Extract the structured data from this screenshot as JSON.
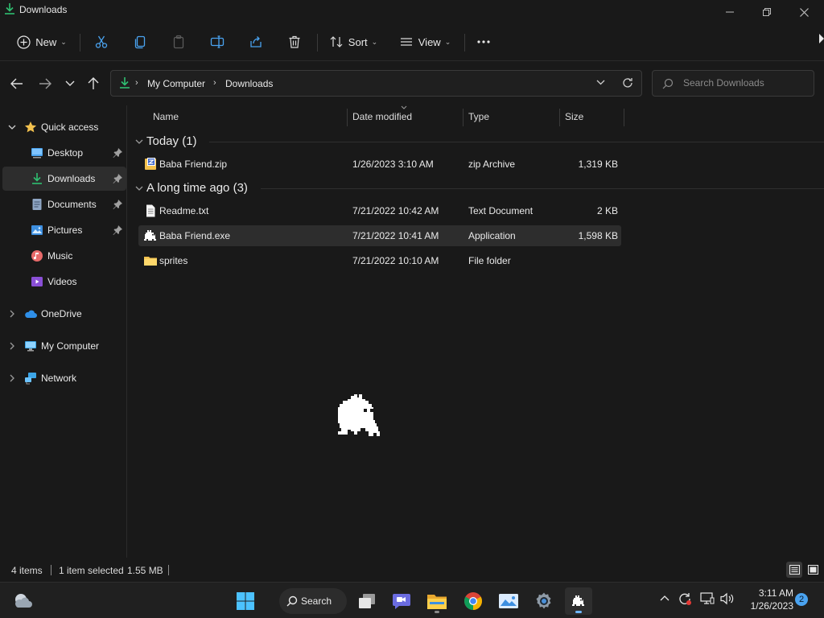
{
  "window": {
    "title": "Downloads"
  },
  "toolbar": {
    "new_label": "New",
    "sort_label": "Sort",
    "view_label": "View"
  },
  "address": {
    "segments": [
      "My Computer",
      "Downloads"
    ]
  },
  "search": {
    "placeholder": "Search Downloads"
  },
  "sidebar": {
    "items": [
      {
        "label": "Quick access"
      },
      {
        "label": "Desktop"
      },
      {
        "label": "Downloads"
      },
      {
        "label": "Documents"
      },
      {
        "label": "Pictures"
      },
      {
        "label": "Music"
      },
      {
        "label": "Videos"
      },
      {
        "label": "OneDrive"
      },
      {
        "label": "My Computer"
      },
      {
        "label": "Network"
      }
    ]
  },
  "columns": {
    "name": "Name",
    "date": "Date modified",
    "type": "Type",
    "size": "Size"
  },
  "groups": [
    {
      "label": "Today (1)",
      "files": [
        {
          "name": "Baba Friend.zip",
          "date": "1/26/2023 3:10 AM",
          "type": "zip Archive",
          "size": "1,319 KB",
          "icon": "zip-icon"
        }
      ]
    },
    {
      "label": "A long time ago (3)",
      "files": [
        {
          "name": "Readme.txt",
          "date": "7/21/2022 10:42 AM",
          "type": "Text Document",
          "size": "2 KB",
          "icon": "text-file-icon"
        },
        {
          "name": "Baba Friend.exe",
          "date": "7/21/2022 10:41 AM",
          "type": "Application",
          "size": "1,598 KB",
          "icon": "baba-app-icon"
        },
        {
          "name": "sprites",
          "date": "7/21/2022 10:10 AM",
          "type": "File folder",
          "size": "",
          "icon": "folder-icon"
        }
      ]
    }
  ],
  "status": {
    "items_count": "4 items",
    "selection": "1 item selected",
    "selection_size": "1.55 MB"
  },
  "taskbar": {
    "search_label": "Search",
    "time": "3:11 AM",
    "date": "1/26/2023",
    "notification_count": "2"
  },
  "colors": {
    "background": "#191919",
    "accent_download": "#2fbf71",
    "folder": "#f2c14e",
    "taskbar": "#202020",
    "selected_row": "#2d2d2d"
  }
}
